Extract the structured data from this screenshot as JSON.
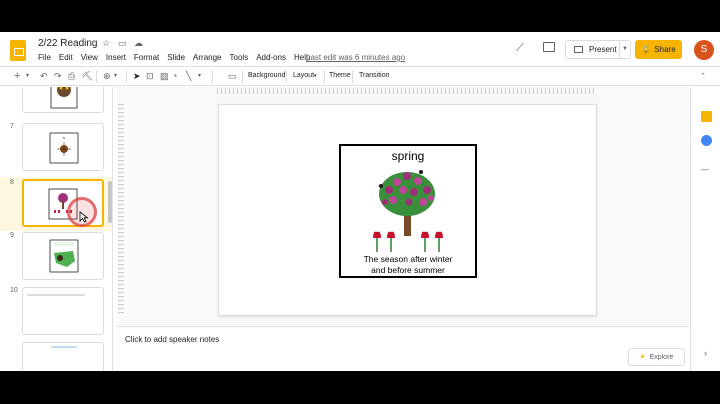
{
  "document": {
    "title": "2/22 Reading",
    "last_edit": "Last edit was 6 minutes ago"
  },
  "menu": [
    "File",
    "Edit",
    "View",
    "Insert",
    "Format",
    "Slide",
    "Arrange",
    "Tools",
    "Add-ons",
    "Help"
  ],
  "header_buttons": {
    "present": "Present",
    "share": "Share",
    "avatar_initial": "S"
  },
  "toolbar": {
    "background": "Background",
    "layout": "Layout",
    "theme": "Theme",
    "transition": "Transition"
  },
  "filmstrip": {
    "slides": [
      {
        "number": "",
        "active": false
      },
      {
        "number": "7",
        "active": false
      },
      {
        "number": "8",
        "active": true
      },
      {
        "number": "9",
        "active": false
      },
      {
        "number": "10",
        "active": false
      }
    ]
  },
  "slide": {
    "word": "spring",
    "definition_line1": "The season after winter",
    "definition_line2": "and before summer"
  },
  "notes": {
    "placeholder": "Click to add speaker notes"
  },
  "explore": {
    "label": "Explore"
  },
  "colors": {
    "brand_yellow": "#f4b400",
    "share_yellow": "#f6b400",
    "avatar": "#d9531e"
  }
}
